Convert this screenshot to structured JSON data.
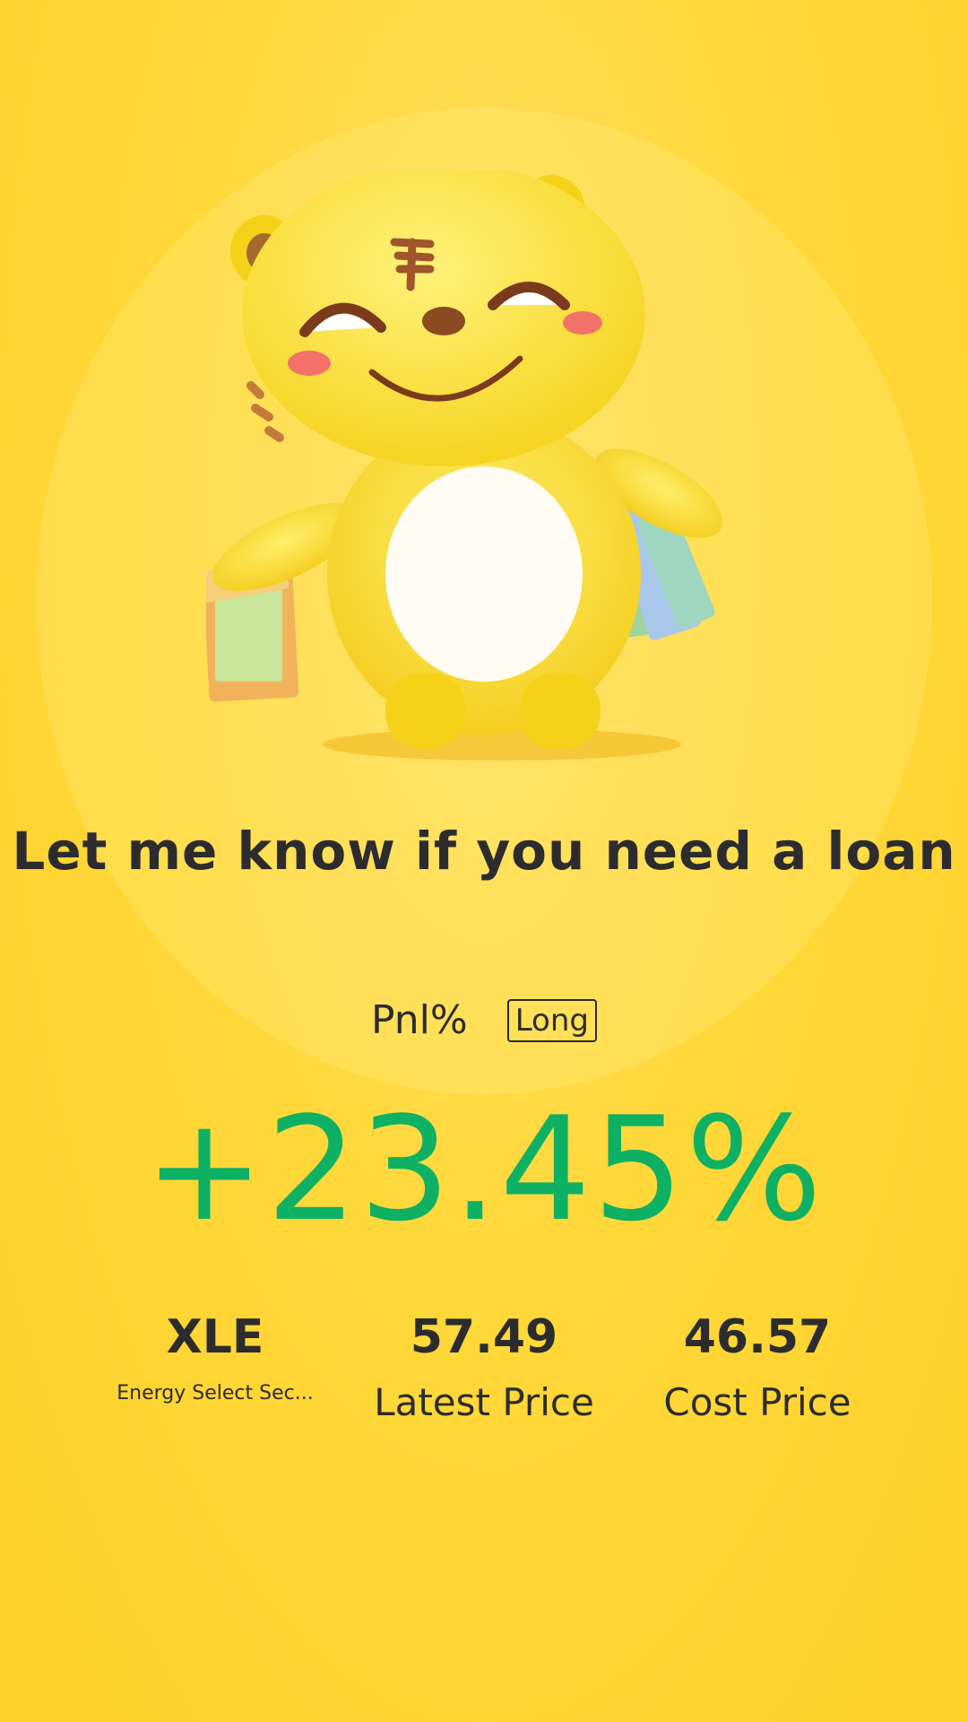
{
  "headline": "Let me know if you need a loan",
  "pnl": {
    "label": "Pnl%",
    "position_badge": "Long",
    "value": "+23.45%",
    "value_color": "#0eb064"
  },
  "stats": {
    "symbol": "XLE",
    "symbol_name": "Energy Select Sec...",
    "latest_price": "57.49",
    "latest_price_label": "Latest Price",
    "cost_price": "46.57",
    "cost_price_label": "Cost Price"
  },
  "mascot": {
    "icon": "tiger-mascot-with-shopping-bags-icon"
  },
  "colors": {
    "background": "#ffd83a",
    "text": "#2c2c2e",
    "positive": "#0eb064"
  }
}
